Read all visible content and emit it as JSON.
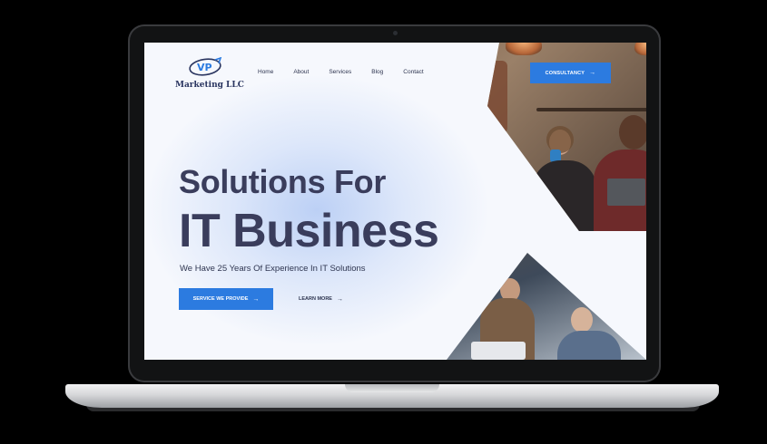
{
  "logo": {
    "mark_text": "VP",
    "brand_name": "Marketing LLC"
  },
  "nav": {
    "items": [
      "Home",
      "About",
      "Services",
      "Blog",
      "Contact"
    ]
  },
  "header": {
    "cta_label": "CONSULTANCY",
    "cta_icon": "arrow-right-icon"
  },
  "hero": {
    "title_line1": "Solutions For",
    "title_line2": "IT Business",
    "subtitle": "We Have 25 Years Of Experience In IT Solutions",
    "primary_button": "SERVICE WE PROVIDE",
    "secondary_link": "LEARN MORE"
  },
  "colors": {
    "accent": "#2c7be0",
    "heading": "#3a3d5c",
    "background": "#f6f8fd",
    "device_frame": "#121314"
  }
}
